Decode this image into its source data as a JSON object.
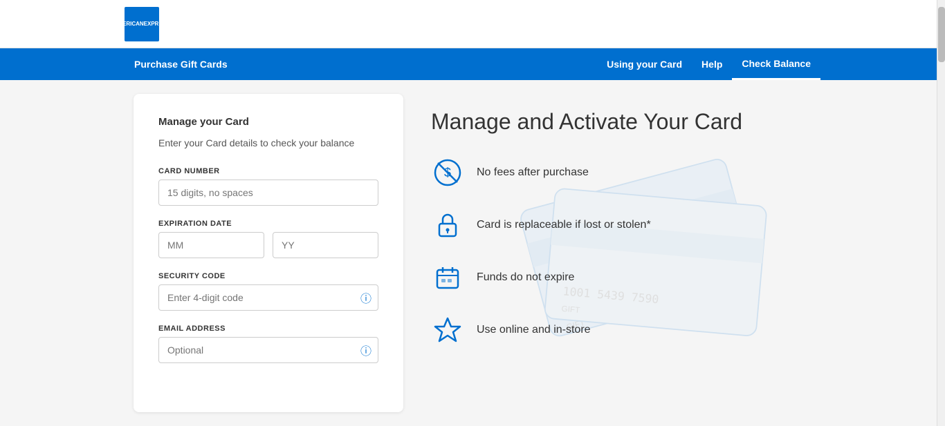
{
  "logo": {
    "line1": "AMERICAN",
    "line2": "EXPRESS"
  },
  "nav": {
    "left_item": "Purchase Gift Cards",
    "right_items": [
      {
        "label": "Using your Card",
        "active": false
      },
      {
        "label": "Help",
        "active": false
      },
      {
        "label": "Check Balance",
        "active": true
      }
    ]
  },
  "form": {
    "title": "Manage your Card",
    "subtitle": "Enter your Card details to check your balance",
    "card_number_label": "CARD NUMBER",
    "card_number_placeholder": "15 digits, no spaces",
    "expiration_label": "EXPIRATION DATE",
    "expiration_mm_placeholder": "MM",
    "expiration_yy_placeholder": "YY",
    "security_code_label": "SECURITY CODE",
    "security_code_placeholder": "Enter 4-digit code",
    "email_label": "EMAIL ADDRESS",
    "email_placeholder": "Optional"
  },
  "info": {
    "title": "Manage and Activate Your Card",
    "features": [
      {
        "id": "no-fees",
        "text": "No fees after purchase"
      },
      {
        "id": "replaceable",
        "text": "Card is replaceable if lost or stolen*"
      },
      {
        "id": "no-expire",
        "text": "Funds do not expire"
      },
      {
        "id": "online",
        "text": "Use online and in-store"
      }
    ]
  },
  "colors": {
    "primary": "#006fcf",
    "text_dark": "#333333",
    "text_muted": "#999999"
  }
}
